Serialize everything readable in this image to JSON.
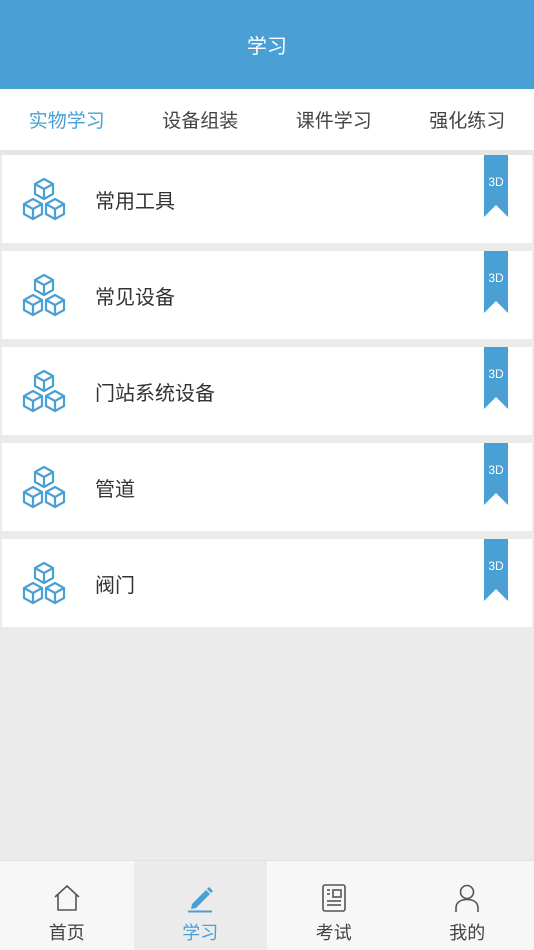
{
  "header": {
    "title": "学习"
  },
  "tabs": [
    {
      "label": "实物学习",
      "active": true
    },
    {
      "label": "设备组装",
      "active": false
    },
    {
      "label": "课件学习",
      "active": false
    },
    {
      "label": "强化练习",
      "active": false
    }
  ],
  "items": [
    {
      "label": "常用工具",
      "icon": "cubes-icon",
      "badge": "3D"
    },
    {
      "label": "常见设备",
      "icon": "cubes-icon",
      "badge": "3D"
    },
    {
      "label": "门站系统设备",
      "icon": "cubes-icon",
      "badge": "3D"
    },
    {
      "label": "管道",
      "icon": "cubes-icon",
      "badge": "3D"
    },
    {
      "label": "阀门",
      "icon": "cubes-icon",
      "badge": "3D"
    }
  ],
  "bottom_nav": [
    {
      "label": "首页",
      "icon": "home-icon",
      "active": false
    },
    {
      "label": "学习",
      "icon": "pen-icon",
      "active": true
    },
    {
      "label": "考试",
      "icon": "exam-icon",
      "active": false
    },
    {
      "label": "我的",
      "icon": "user-icon",
      "active": false
    }
  ],
  "colors": {
    "accent": "#4aa0d5",
    "background": "#ebebeb"
  }
}
